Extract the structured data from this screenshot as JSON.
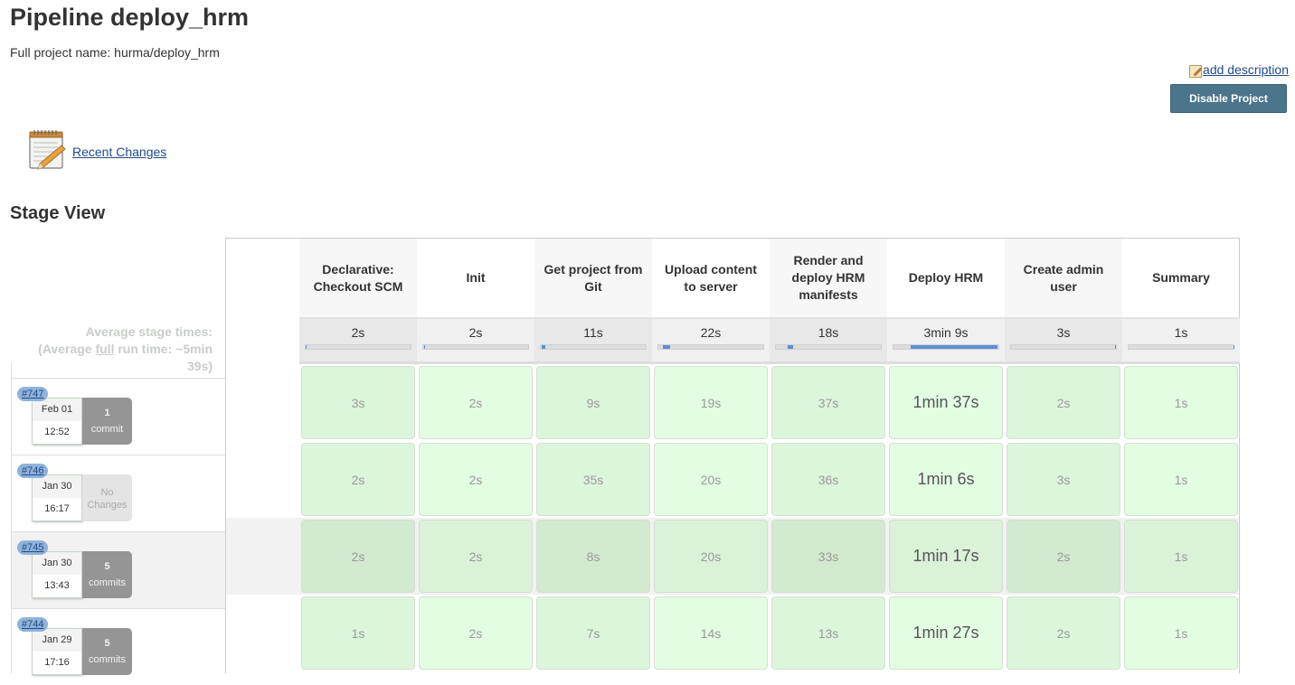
{
  "header": {
    "title": "Pipeline deploy_hrm",
    "full_project_name": "Full project name: hurma/deploy_hrm",
    "add_description": "add description",
    "disable_button": "Disable Project"
  },
  "recent_changes": {
    "label": "Recent Changes",
    "icon": "notepad-pencil-icon"
  },
  "stage_view": {
    "title": "Stage View",
    "avg_label_1": "Average stage times:",
    "avg_label_2a": "(Average ",
    "avg_label_2b": "full",
    "avg_label_2c": " run time: ~5min 39s)",
    "stages": [
      {
        "name": "Declarative: Checkout SCM",
        "avg": "2s",
        "avg_share": [
          0.0,
          0.006
        ]
      },
      {
        "name": "Init",
        "avg": "2s",
        "avg_share": [
          0.006,
          0.012
        ]
      },
      {
        "name": "Get project from Git",
        "avg": "11s",
        "avg_share": [
          0.012,
          0.045
        ]
      },
      {
        "name": "Upload content to server",
        "avg": "22s",
        "avg_share": [
          0.045,
          0.11
        ]
      },
      {
        "name": "Render and deploy HRM manifests",
        "avg": "18s",
        "avg_share": [
          0.11,
          0.163
        ]
      },
      {
        "name": "Deploy HRM",
        "avg": "3min 9s",
        "avg_share": [
          0.163,
          0.99
        ]
      },
      {
        "name": "Create admin user",
        "avg": "3s",
        "avg_share": [
          0.99,
          0.998
        ]
      },
      {
        "name": "Summary",
        "avg": "1s",
        "avg_share": [
          0.998,
          1.0
        ]
      }
    ],
    "builds": [
      {
        "id": "#747",
        "date": "Feb 01",
        "time": "12:52",
        "changes_count": "1",
        "changes_label": "commit",
        "has_changes": true,
        "durations": [
          "3s",
          "2s",
          "9s",
          "19s",
          "37s",
          "1min 37s",
          "2s",
          "1s"
        ]
      },
      {
        "id": "#746",
        "date": "Jan 30",
        "time": "16:17",
        "changes_count": "No",
        "changes_label": "Changes",
        "has_changes": false,
        "durations": [
          "2s",
          "2s",
          "35s",
          "20s",
          "36s",
          "1min 6s",
          "3s",
          "1s"
        ]
      },
      {
        "id": "#745",
        "date": "Jan 30",
        "time": "13:43",
        "changes_count": "5",
        "changes_label": "commits",
        "has_changes": true,
        "highlighted": true,
        "durations": [
          "2s",
          "2s",
          "8s",
          "20s",
          "33s",
          "1min 17s",
          "2s",
          "1s"
        ]
      },
      {
        "id": "#744",
        "date": "Jan 29",
        "time": "17:16",
        "changes_count": "5",
        "changes_label": "commits",
        "has_changes": true,
        "durations": [
          "1s",
          "2s",
          "7s",
          "14s",
          "13s",
          "1min 27s",
          "2s",
          "1s"
        ]
      }
    ]
  },
  "colors": {
    "cell_light": "#e3fde3",
    "cell_mid": "#dcf6dc",
    "cell_hl_dark": "#d2eacf",
    "cell_hl_light": "#d9f2d8",
    "badge": "#8fb3d9",
    "button": "#4b758b",
    "link": "#204a87"
  }
}
